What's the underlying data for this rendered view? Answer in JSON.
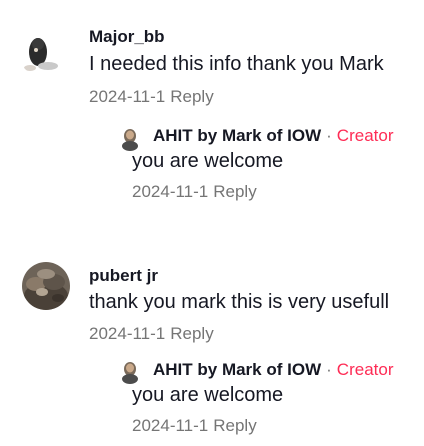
{
  "comments": [
    {
      "username": "Major_bb",
      "text": "I needed this info thank you Mark",
      "date": "2024-11-1",
      "reply_label": "Reply",
      "reply": {
        "author": "AHIT by Mark of IOW",
        "separator": "·",
        "creator_badge": "Creator",
        "text": "you are welcome",
        "date": "2024-11-1",
        "reply_label": "Reply"
      }
    },
    {
      "username": "pubert jr",
      "text": "thank you mark this is very usefull",
      "date": "2024-11-1",
      "reply_label": "Reply",
      "reply": {
        "author": "AHIT by Mark of IOW",
        "separator": "·",
        "creator_badge": "Creator",
        "text": "you are welcome",
        "date": "2024-11-1",
        "reply_label": "Reply"
      }
    }
  ],
  "colors": {
    "text_primary": "#161823",
    "text_secondary": "#757575",
    "creator_accent": "#fe2c55",
    "background": "#ffffff"
  },
  "icons": {
    "avatar_1": "cat-avatar",
    "avatar_2": "rocks-avatar",
    "creator_avatar": "creator-avatar"
  }
}
